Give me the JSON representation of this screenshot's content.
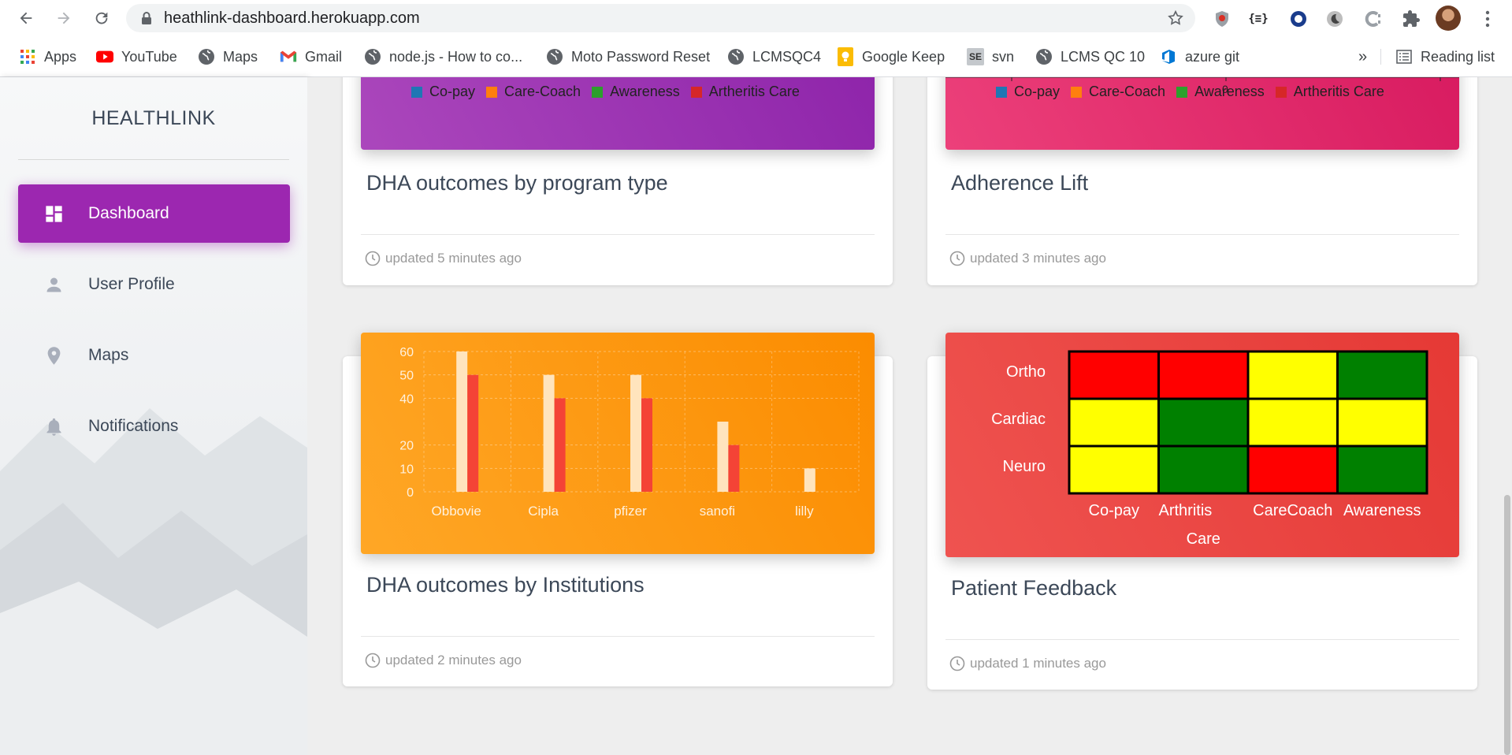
{
  "browser": {
    "url": "heathlink-dashboard.herokuapp.com",
    "bookmarks": [
      {
        "label": "Apps",
        "icon": "apps-grid-icon"
      },
      {
        "label": "YouTube",
        "icon": "youtube-icon"
      },
      {
        "label": "Maps",
        "icon": "globe-icon"
      },
      {
        "label": "Gmail",
        "icon": "gmail-icon"
      },
      {
        "label": "node.js - How to co...",
        "icon": "globe-icon"
      },
      {
        "label": "Moto Password Reset",
        "icon": "globe-icon"
      },
      {
        "label": "LCMSQC4",
        "icon": "globe-icon"
      },
      {
        "label": "Google Keep",
        "icon": "keep-icon"
      },
      {
        "label": "svn",
        "icon": "se-icon"
      },
      {
        "label": "LCMS QC 10",
        "icon": "globe-icon"
      },
      {
        "label": "azure git",
        "icon": "azure-icon"
      }
    ],
    "more_label": "»",
    "reading_list": "Reading list"
  },
  "sidebar": {
    "brand": "HEALTHLINK",
    "items": [
      {
        "label": "Dashboard",
        "icon": "dashboard-icon",
        "active": true
      },
      {
        "label": "User Profile",
        "icon": "person-icon",
        "active": false
      },
      {
        "label": "Maps",
        "icon": "location-pin-icon",
        "active": false
      },
      {
        "label": "Notifications",
        "icon": "bell-icon",
        "active": false
      }
    ]
  },
  "cards": {
    "program_type": {
      "title": "DHA outcomes by program type",
      "updated": "updated 5 minutes ago",
      "legend": [
        "Co-pay",
        "Care-Coach",
        "Awareness",
        "Artheritis Care"
      ],
      "color": "#9c27b0"
    },
    "adherence": {
      "title": "Adherence Lift",
      "updated": "updated 3 minutes ago",
      "legend": [
        "Co-pay",
        "Care-Coach",
        "Awareness",
        "Artheritis Care"
      ],
      "axis_tick": "0",
      "color": "#e91e63"
    },
    "institutions": {
      "title": "DHA outcomes by Institutions",
      "updated": "updated 2 minutes ago",
      "color": "#ff9800"
    },
    "feedback": {
      "title": "Patient Feedback",
      "updated": "updated 1 minutes ago",
      "color": "#e53935"
    }
  },
  "legend_colors": [
    "#1f77b4",
    "#ff7f0e",
    "#2ca02c",
    "#d62728"
  ],
  "chart_data": [
    {
      "type": "bar",
      "categories": [
        "Obbovie",
        "Cipla",
        "pfizer",
        "sanofi",
        "lilly"
      ],
      "series": [
        {
          "values": [
            60,
            50,
            50,
            30,
            10
          ],
          "color": "#ffe4bd"
        },
        {
          "values": [
            50,
            40,
            40,
            20,
            0
          ],
          "color": "#f44336"
        }
      ],
      "yticks": [
        0,
        10,
        20,
        40,
        50,
        60
      ],
      "ylim": [
        0,
        60
      ],
      "grid": true
    },
    {
      "type": "heatmap",
      "rows": [
        "Ortho",
        "Cardiac",
        "Neuro"
      ],
      "columns": [
        "Co-pay",
        "Arthritis Care",
        "CareCoach",
        "Awareness"
      ],
      "cells": [
        [
          "red",
          "red",
          "yellow",
          "green"
        ],
        [
          "yellow",
          "green",
          "yellow",
          "yellow"
        ],
        [
          "yellow",
          "green",
          "red",
          "green"
        ]
      ],
      "colors": {
        "red": "#ff0000",
        "yellow": "#ffff00",
        "green": "#008000"
      }
    }
  ]
}
